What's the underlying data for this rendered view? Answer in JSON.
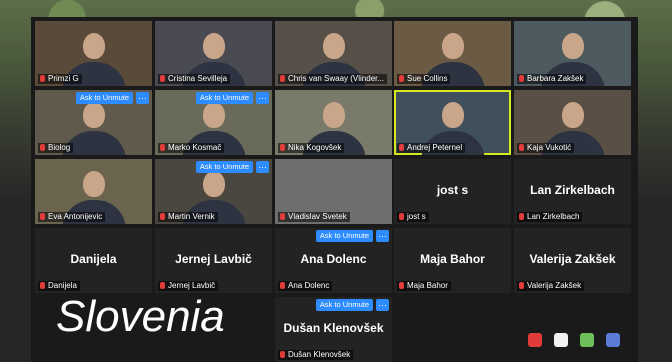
{
  "caption": "Slovenia",
  "unmute_label": "Ask to Unmute",
  "more_label": "…",
  "participants": [
    {
      "name": "Primzi G",
      "display": "video"
    },
    {
      "name": "Cristina Sevilleja",
      "display": "video"
    },
    {
      "name": "Chris van Swaay (Vlinder...",
      "display": "video"
    },
    {
      "name": "Sue Collins",
      "display": "video"
    },
    {
      "name": "Barbara Zakšek",
      "display": "video"
    },
    {
      "name": "Biolog",
      "display": "video",
      "unmute": true
    },
    {
      "name": "Marko Kosmač",
      "display": "video",
      "unmute": true
    },
    {
      "name": "Nika Kogovšek",
      "display": "video"
    },
    {
      "name": "Andrej Peternel",
      "display": "video",
      "active": true
    },
    {
      "name": "Kaja Vukotić",
      "display": "video"
    },
    {
      "name": "Eva Antonijevic",
      "display": "video"
    },
    {
      "name": "Martin Vernik",
      "display": "video",
      "unmute": true
    },
    {
      "name": "Vladislav Svetek",
      "display": "video"
    },
    {
      "name": "jost s",
      "display": "name"
    },
    {
      "name": "Lan Zirkelbach",
      "display": "name"
    },
    {
      "name": "Danijela",
      "display": "name"
    },
    {
      "name": "Jernej Lavbič",
      "display": "name"
    },
    {
      "name": "Ana Dolenc",
      "display": "name",
      "unmute": true
    },
    {
      "name": "Maja Bahor",
      "display": "name"
    },
    {
      "name": "Valerija Zakšek",
      "display": "name"
    },
    {
      "name": "Dušan Klenovšek",
      "display": "name",
      "unmute": true
    }
  ],
  "tray_icons": [
    {
      "name": "chat-icon",
      "color": "#e23b3b"
    },
    {
      "name": "reactions-icon",
      "color": "#f2f2f2"
    },
    {
      "name": "share-icon",
      "color": "#6fbf5a"
    },
    {
      "name": "apps-icon",
      "color": "#5b7bd6"
    }
  ]
}
